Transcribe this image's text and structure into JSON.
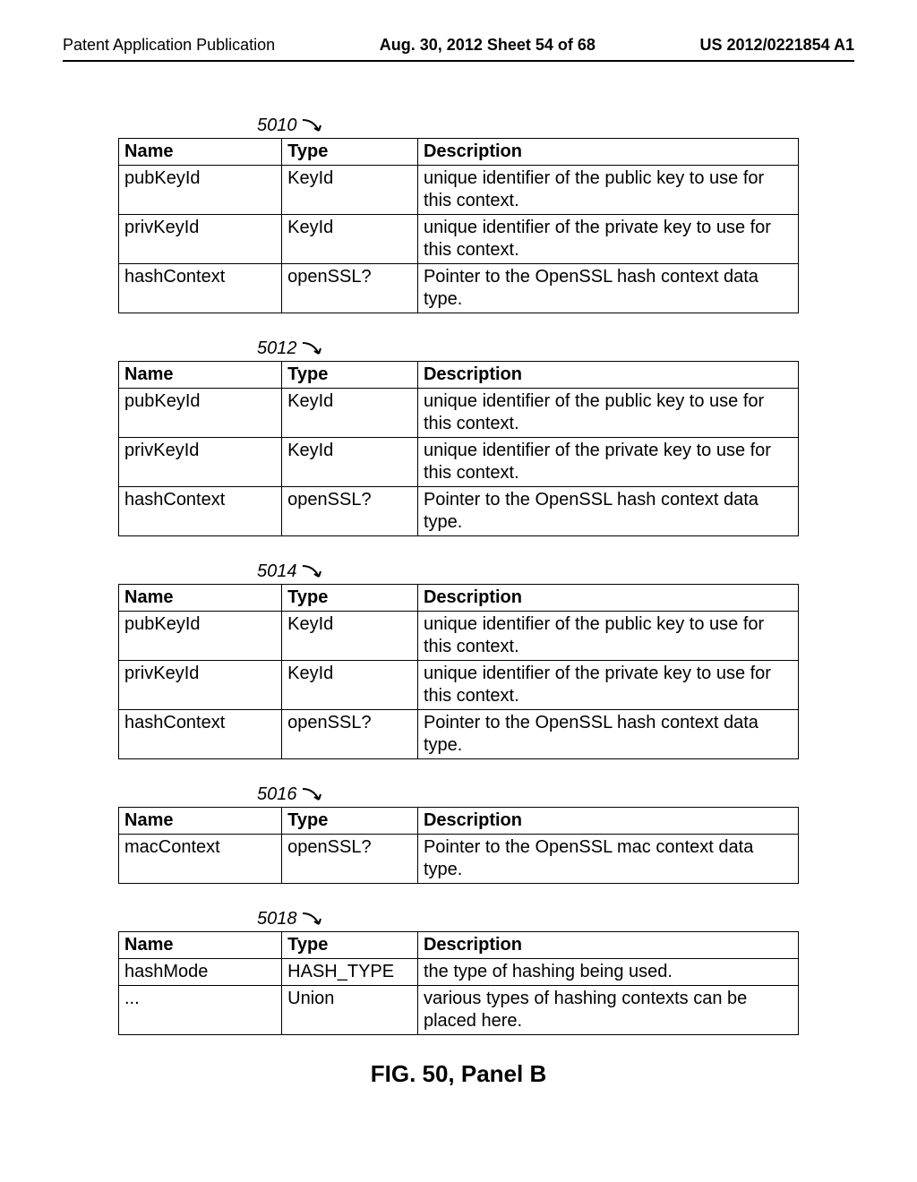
{
  "header": {
    "left": "Patent Application Publication",
    "center": "Aug. 30, 2012  Sheet 54 of 68",
    "right": "US 2012/0221854 A1"
  },
  "columns": {
    "name": "Name",
    "type": "Type",
    "desc": "Description"
  },
  "tables": [
    {
      "ref": "5010",
      "rows": [
        {
          "name": "pubKeyId",
          "type": "KeyId",
          "desc": "unique identifier of the public key to use for this context."
        },
        {
          "name": "privKeyId",
          "type": "KeyId",
          "desc": "unique identifier of the private key to use for this context."
        },
        {
          "name": "hashContext",
          "type": "openSSL?",
          "desc": "Pointer to the OpenSSL hash context data type."
        }
      ]
    },
    {
      "ref": "5012",
      "rows": [
        {
          "name": "pubKeyId",
          "type": "KeyId",
          "desc": "unique identifier of the public key to use for this context."
        },
        {
          "name": "privKeyId",
          "type": "KeyId",
          "desc": "unique identifier of the private key to use for this context."
        },
        {
          "name": "hashContext",
          "type": "openSSL?",
          "desc": "Pointer to the OpenSSL hash context data type."
        }
      ]
    },
    {
      "ref": "5014",
      "rows": [
        {
          "name": "pubKeyId",
          "type": "KeyId",
          "desc": "unique identifier of the public key to use for this context."
        },
        {
          "name": "privKeyId",
          "type": "KeyId",
          "desc": "unique identifier of the private key to use for this context."
        },
        {
          "name": "hashContext",
          "type": "openSSL?",
          "desc": "Pointer to the OpenSSL hash context data type."
        }
      ]
    },
    {
      "ref": "5016",
      "rows": [
        {
          "name": "macContext",
          "type": "openSSL?",
          "desc": "Pointer to the OpenSSL mac context data type."
        }
      ]
    },
    {
      "ref": "5018",
      "rows": [
        {
          "name": "hashMode",
          "type": "HASH_TYPE",
          "desc": "the type of hashing being used."
        },
        {
          "name": "...",
          "type": "Union",
          "desc": "various types of hashing contexts can be placed here."
        }
      ]
    }
  ],
  "figure_title": "FIG. 50, Panel B"
}
